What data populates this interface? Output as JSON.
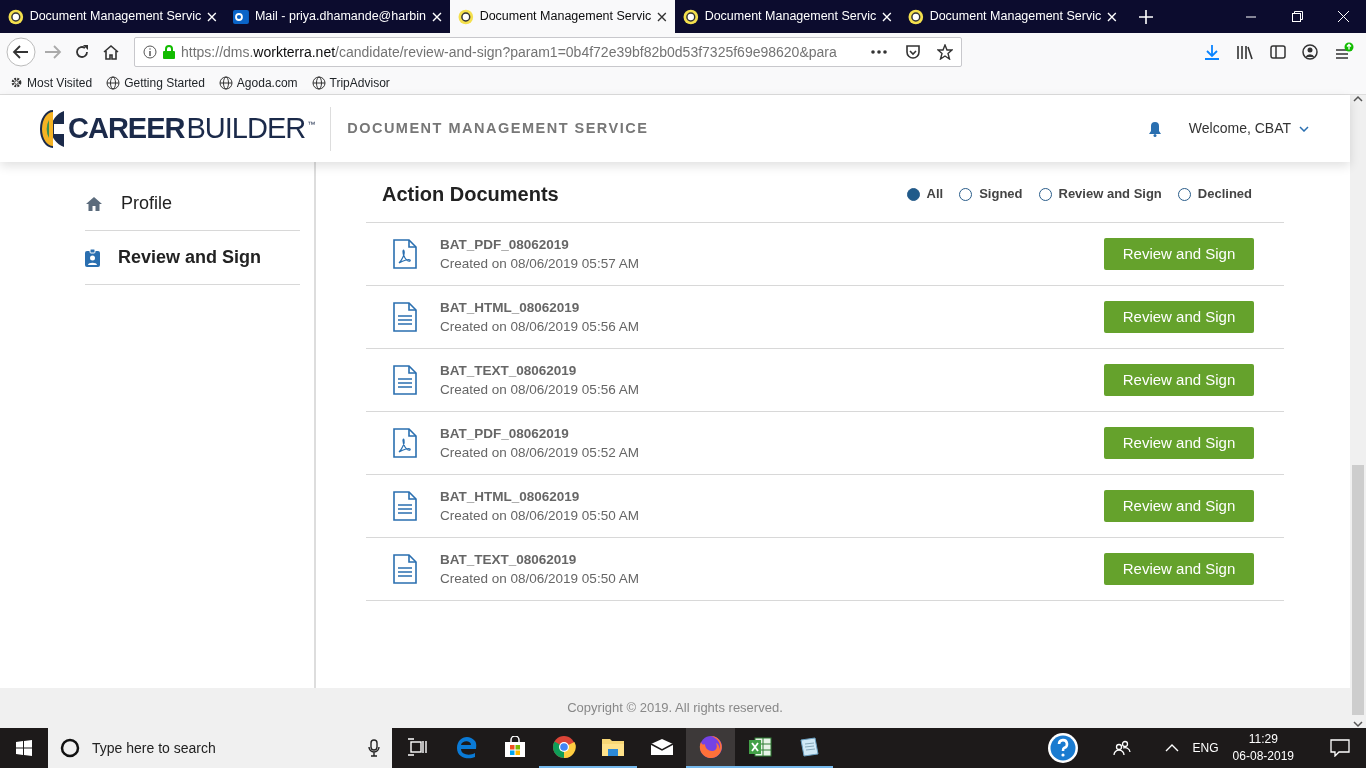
{
  "browser": {
    "tabs": [
      {
        "title": "Document Management Servic",
        "kind": "site",
        "selected": false
      },
      {
        "title": "Mail - priya.dhamande@harbin",
        "kind": "mail",
        "selected": false
      },
      {
        "title": "Document Management Servic",
        "kind": "site",
        "selected": true
      },
      {
        "title": "Document Management Servic",
        "kind": "site",
        "selected": false
      },
      {
        "title": "Document Management Servic",
        "kind": "site",
        "selected": false
      }
    ],
    "url": {
      "prefix": "https://dms.",
      "domain": "workterra.net",
      "rest": "/candidate/review-and-sign?param1=0b4f72e39bf82b0d53f7325f69e98620&para"
    },
    "bookmarks": [
      {
        "label": "Most Visited",
        "kind": "folder"
      },
      {
        "label": "Getting Started",
        "kind": "site"
      },
      {
        "label": "Agoda.com",
        "kind": "site"
      },
      {
        "label": "TripAdvisor",
        "kind": "site"
      }
    ]
  },
  "header": {
    "logo": {
      "bold": "CAREER",
      "light": "BUILDER",
      "tm": "™"
    },
    "service": "DOCUMENT MANAGEMENT SERVICE",
    "welcome": "Welcome, CBAT"
  },
  "sidebar": {
    "items": [
      {
        "label": "Profile",
        "kind": "profile",
        "selected": false
      },
      {
        "label": "Review and Sign",
        "kind": "review",
        "selected": true
      }
    ]
  },
  "content": {
    "title": "Action Documents",
    "filters": [
      {
        "label": "All",
        "selected": true
      },
      {
        "label": "Signed",
        "selected": false
      },
      {
        "label": "Review and Sign",
        "selected": false
      },
      {
        "label": "Declined",
        "selected": false
      }
    ],
    "documents": [
      {
        "kind": "pdf",
        "name": "BAT_PDF_08062019",
        "created": "Created on 08/06/2019 05:57 AM",
        "action": "Review and Sign"
      },
      {
        "kind": "text",
        "name": "BAT_HTML_08062019",
        "created": "Created on 08/06/2019 05:56 AM",
        "action": "Review and Sign"
      },
      {
        "kind": "text",
        "name": "BAT_TEXT_08062019",
        "created": "Created on 08/06/2019 05:56 AM",
        "action": "Review and Sign"
      },
      {
        "kind": "pdf",
        "name": "BAT_PDF_08062019",
        "created": "Created on 08/06/2019 05:52 AM",
        "action": "Review and Sign"
      },
      {
        "kind": "text",
        "name": "BAT_HTML_08062019",
        "created": "Created on 08/06/2019 05:50 AM",
        "action": "Review and Sign"
      },
      {
        "kind": "text",
        "name": "BAT_TEXT_08062019",
        "created": "Created on 08/06/2019 05:50 AM",
        "action": "Review and Sign"
      }
    ]
  },
  "footer": "Copyright © 2019. All rights reserved.",
  "taskbar": {
    "search_placeholder": "Type here to search",
    "apps": [
      {
        "kind": "taskview",
        "running": false,
        "selected": false
      },
      {
        "kind": "edge",
        "running": false,
        "selected": false
      },
      {
        "kind": "store",
        "running": false,
        "selected": false
      },
      {
        "kind": "chrome",
        "running": true,
        "selected": false
      },
      {
        "kind": "explorer",
        "running": true,
        "selected": false
      },
      {
        "kind": "mail",
        "running": false,
        "selected": false
      },
      {
        "kind": "firefox",
        "running": true,
        "selected": true
      },
      {
        "kind": "excel",
        "running": true,
        "selected": false
      },
      {
        "kind": "notepad",
        "running": true,
        "selected": false
      }
    ],
    "language": "ENG",
    "time": "11:29",
    "date": "06-08-2019"
  }
}
